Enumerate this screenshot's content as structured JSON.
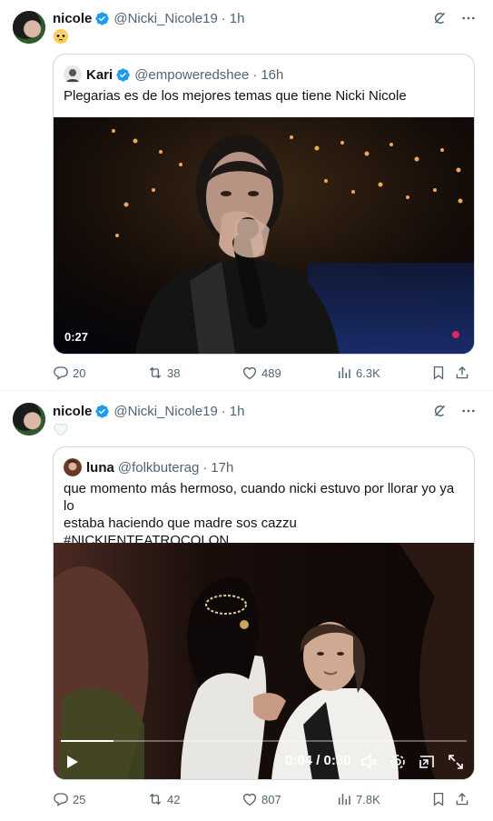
{
  "tweets": [
    {
      "author": {
        "name": "nicole",
        "handle": "@Nicki_Nicole19",
        "time": "1h"
      },
      "content_emoji": "pleading-face-emoji",
      "quote": {
        "author": {
          "name": "Kari",
          "handle": "@empoweredshee",
          "time": "16h"
        },
        "text": "Plegarias es de los mejores temas que tiene Nicki Nicole",
        "video": {
          "time": "0:27"
        }
      },
      "stats": {
        "replies": "20",
        "reposts": "38",
        "likes": "489",
        "views": "6.3K"
      }
    },
    {
      "author": {
        "name": "nicole",
        "handle": "@Nicki_Nicole19",
        "time": "1h"
      },
      "content_emoji": "white-heart-emoji",
      "quote": {
        "author": {
          "name": "luna",
          "handle": "@folkbuterag",
          "time": "17h"
        },
        "text_lines": [
          "que momento más hermoso, cuando nicki estuvo por llorar yo ya lo",
          "estaba haciendo que madre sos cazzu",
          "#NICKIENTEATROCOLON"
        ],
        "video": {
          "time": "0:04 / 0:30",
          "progress": 0.13
        }
      },
      "stats": {
        "replies": "25",
        "reposts": "42",
        "likes": "807",
        "views": "7.8K"
      }
    }
  ],
  "colors": {
    "text": "#0f1419",
    "muted": "#536471",
    "verified": "#1d9bf0",
    "border": "#cfd9de"
  }
}
